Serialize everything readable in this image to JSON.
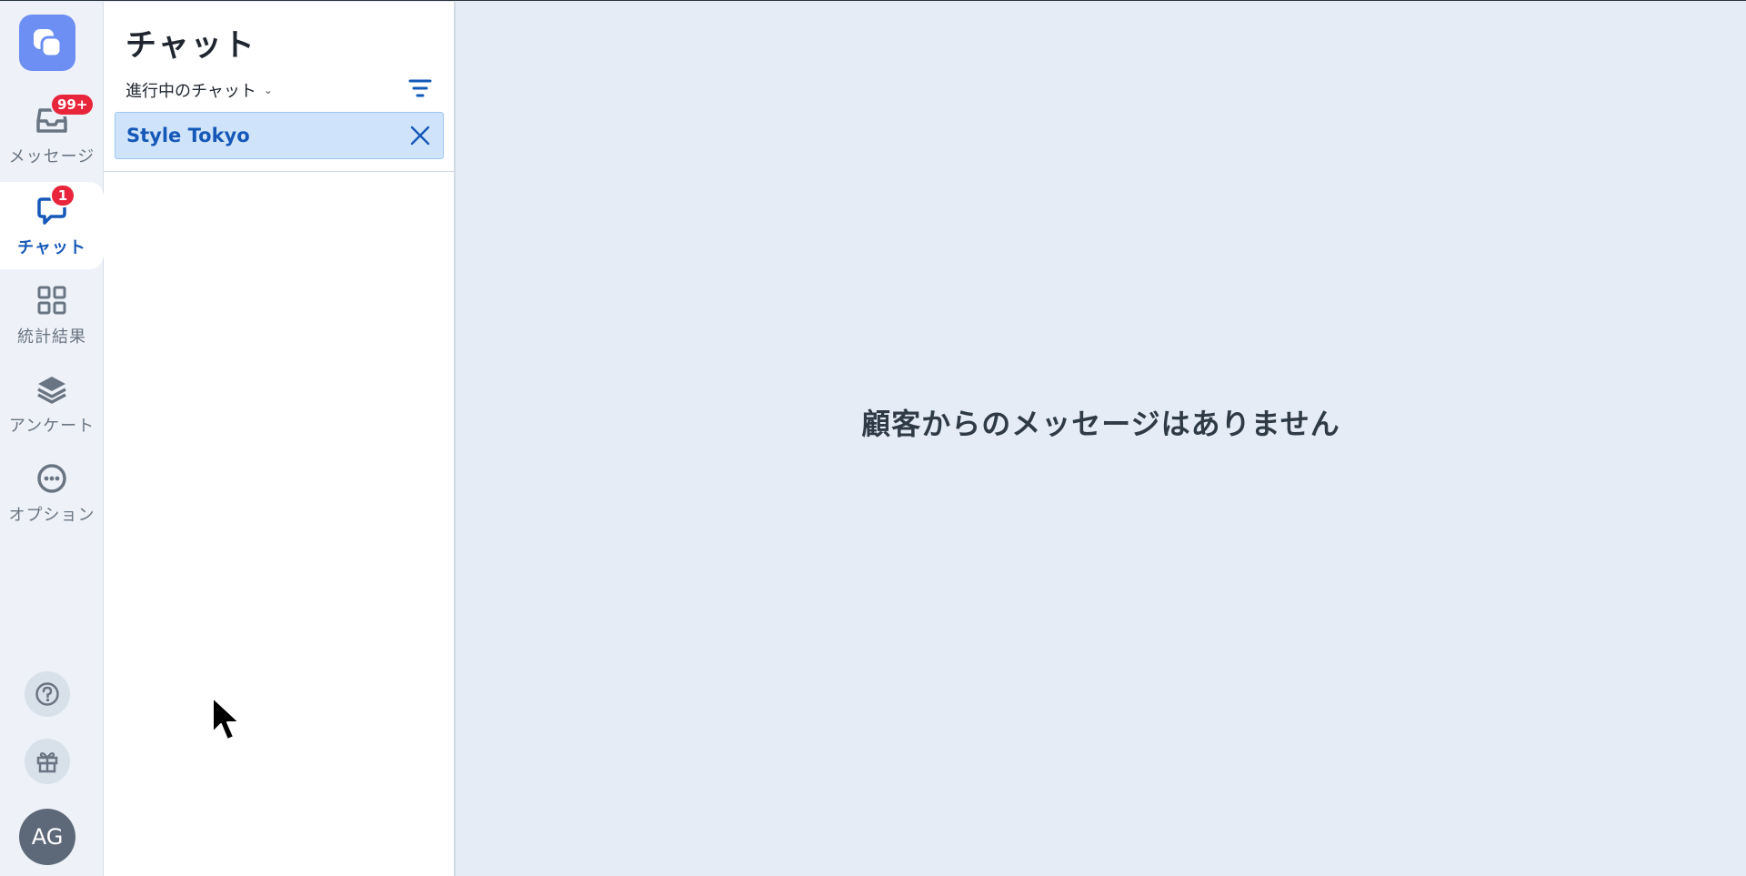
{
  "sidebar": {
    "items": [
      {
        "label": "メッセージ",
        "icon": "inbox-icon",
        "badge": "99+"
      },
      {
        "label": "チャット",
        "icon": "chat-icon",
        "badge": "1",
        "active": true
      },
      {
        "label": "統計結果",
        "icon": "grid-icon"
      },
      {
        "label": "アンケート",
        "icon": "layers-icon"
      },
      {
        "label": "オプション",
        "icon": "more-icon"
      }
    ],
    "help_icon": "help-icon",
    "gift_icon": "gift-icon",
    "avatar_initials": "AG",
    "accent_color": "#1558b8",
    "logo_color": "#6d8ff3",
    "badge_color": "#e8253a"
  },
  "panel": {
    "title": "チャット",
    "filter_label": "進行中のチャット",
    "filter_icon": "filter-icon",
    "chip": {
      "label": "Style Tokyo",
      "close_icon": "close-icon"
    }
  },
  "main": {
    "empty_message": "顧客からのメッセージはありません"
  }
}
